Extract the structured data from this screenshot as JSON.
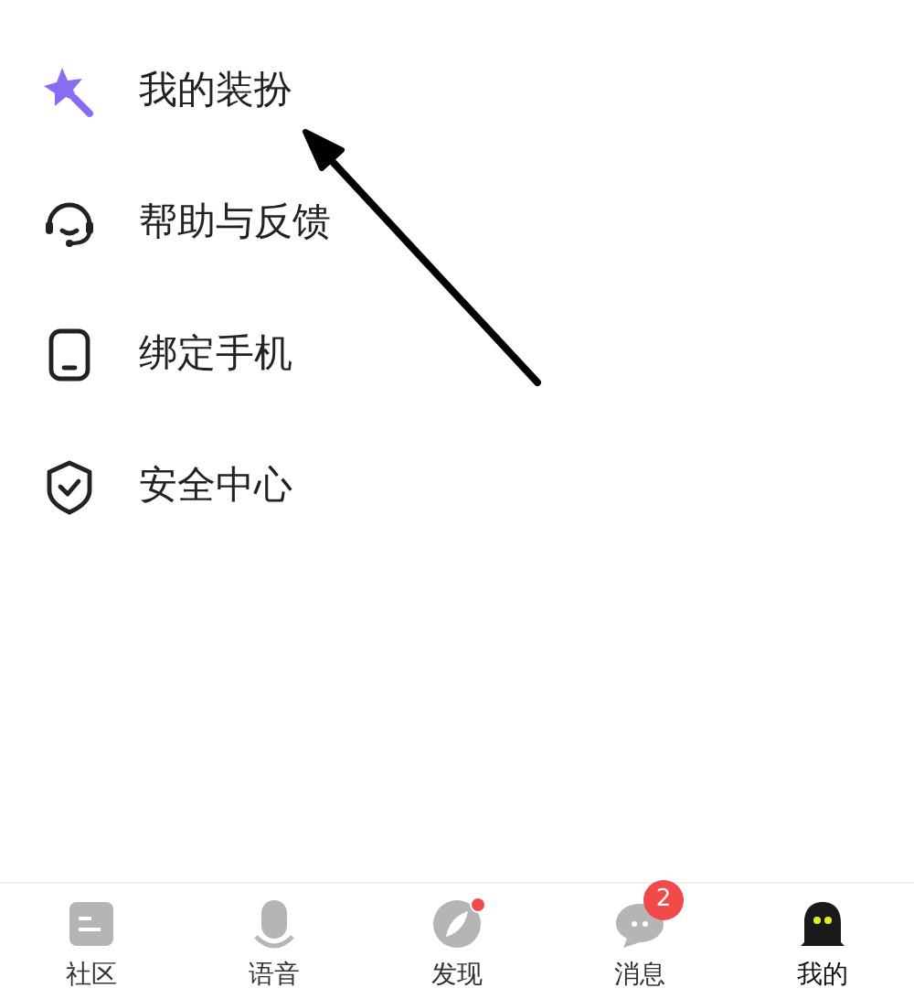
{
  "menu": [
    {
      "kind": "dress",
      "label": "我的装扮"
    },
    {
      "kind": "help",
      "label": "帮助与反馈"
    },
    {
      "kind": "phone",
      "label": "绑定手机"
    },
    {
      "kind": "security",
      "label": "安全中心"
    }
  ],
  "tabs": [
    {
      "kind": "community",
      "label": "社区",
      "selected": false,
      "dot": false
    },
    {
      "kind": "voice",
      "label": "语音",
      "selected": false,
      "dot": false
    },
    {
      "kind": "discover",
      "label": "发现",
      "selected": false,
      "dot": true
    },
    {
      "kind": "messages",
      "label": "消息",
      "selected": false,
      "dot": false,
      "badge": "2"
    },
    {
      "kind": "me",
      "label": "我的",
      "selected": true,
      "dot": false
    }
  ]
}
